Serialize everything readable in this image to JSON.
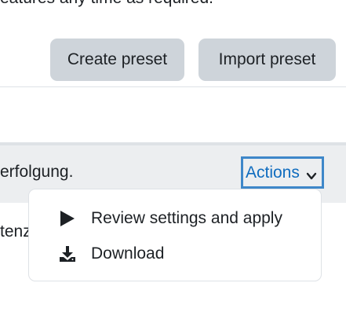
{
  "intro": {
    "text_fragment": "eatures any time as required."
  },
  "buttons": {
    "create_preset": "Create preset",
    "import_preset": "Import preset"
  },
  "row": {
    "text_fragment": "erfolgung.",
    "actions_label": "Actions"
  },
  "row2": {
    "text_fragment": "tenz"
  },
  "menu": {
    "items": [
      {
        "label": "Review settings and apply",
        "icon": "play-icon"
      },
      {
        "label": "Download",
        "icon": "download-icon"
      }
    ]
  },
  "colors": {
    "button_bg": "#ced4da",
    "link": "#0f6cbf",
    "focus_border": "#3e87c9",
    "row_bg": "#eceef0"
  }
}
